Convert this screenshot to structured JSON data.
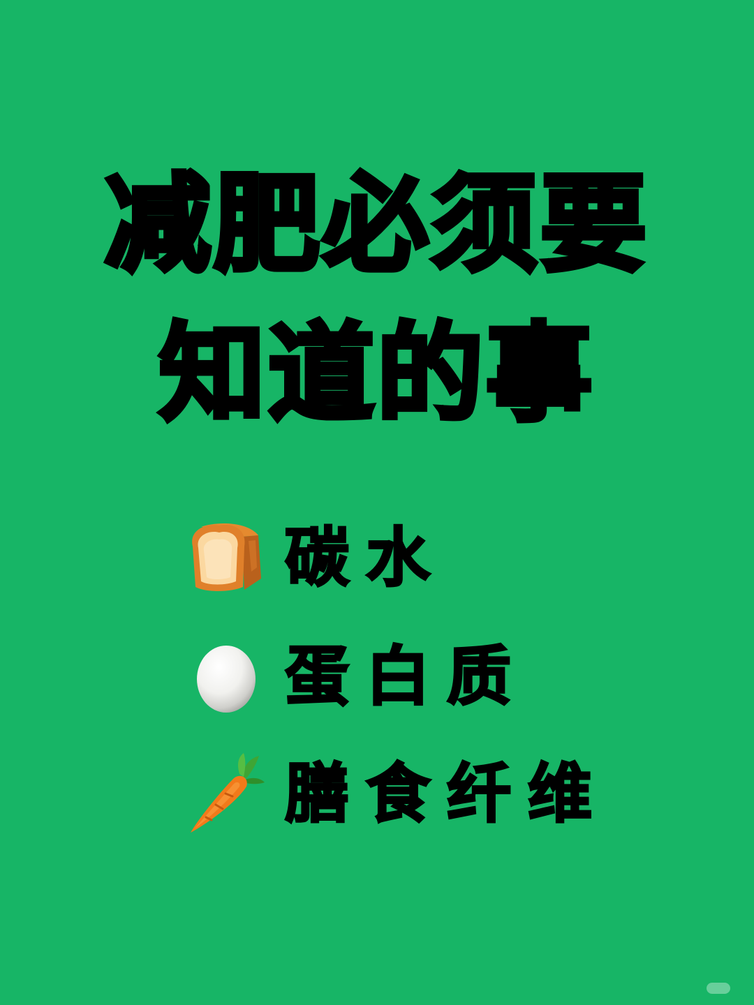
{
  "title": {
    "line1": "减肥必须要",
    "line2": "知道的事"
  },
  "items": [
    {
      "icon": "bread-icon",
      "label": "碳水"
    },
    {
      "icon": "egg-icon",
      "label": "蛋白质"
    },
    {
      "icon": "carrot-icon",
      "label": "膳食纤维"
    }
  ],
  "colors": {
    "background": "#17b566",
    "text": "#000000"
  }
}
